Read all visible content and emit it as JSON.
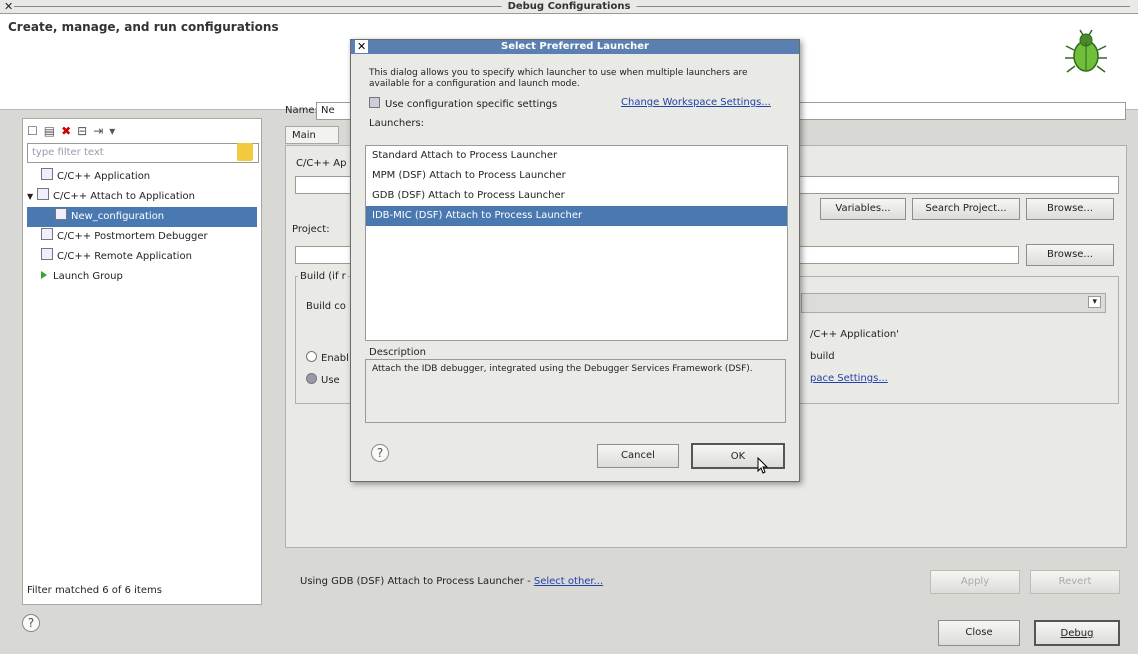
{
  "window": {
    "title": "Debug Configurations",
    "close_glyph": "✕"
  },
  "header": {
    "heading": "Create, manage, and run configurations",
    "icon": "bug-icon"
  },
  "left": {
    "toolbar_icons": [
      "new-config-icon",
      "duplicate-icon",
      "delete-icon",
      "collapse-all-icon",
      "filter-icon",
      "dropdown-icon"
    ],
    "filter_placeholder": "type filter text",
    "tree": [
      {
        "label": "C/C++ Application",
        "level": 0
      },
      {
        "label": "C/C++ Attach to Application",
        "level": 0,
        "expanded": true
      },
      {
        "label": "New_configuration",
        "level": 1,
        "selected": true
      },
      {
        "label": "C/C++ Postmortem Debugger",
        "level": 0
      },
      {
        "label": "C/C++ Remote Application",
        "level": 0
      },
      {
        "label": "Launch Group",
        "level": 0
      }
    ],
    "status": "Filter matched 6 of 6 items"
  },
  "editor": {
    "name_label": "Name:",
    "name_value": "Ne",
    "tab_main": "Main",
    "cpp_app_label": "C/C++ Ap",
    "variables_btn": "Variables...",
    "search_project_btn": "Search Project...",
    "browse_btn": "Browse...",
    "project_label": "Project:",
    "browse2_btn": "Browse...",
    "build_group_label": "Build (if r",
    "build_config_label": "Build co",
    "cpp_app_text": "/C++ Application'",
    "enable_label": "Enabl",
    "build_text": "build",
    "use_label": "Use",
    "workspace_settings_link": "pace Settings...",
    "launcher_text": "Using GDB (DSF) Attach to Process Launcher - ",
    "select_other_link": "Select other...",
    "apply_btn": "Apply",
    "revert_btn": "Revert"
  },
  "footer": {
    "close_btn": "Close",
    "debug_btn": "Debug"
  },
  "modal": {
    "title": "Select Preferred Launcher",
    "description": "This dialog allows you to specify which launcher to use when multiple launchers are available for a configuration and launch mode.",
    "use_specific_label": "Use configuration specific settings",
    "change_workspace_link": "Change Workspace Settings...",
    "launchers_label": "Launchers:",
    "launchers": [
      "Standard Attach to Process Launcher",
      "MPM (DSF) Attach to Process Launcher",
      "GDB (DSF) Attach to Process Launcher",
      "IDB-MIC (DSF) Attach to Process Launcher"
    ],
    "selected_index": 3,
    "description_label": "Description",
    "description_text": "Attach the IDB debugger, integrated using the Debugger Services Framework (DSF).",
    "cancel_btn": "Cancel",
    "ok_btn": "OK"
  }
}
